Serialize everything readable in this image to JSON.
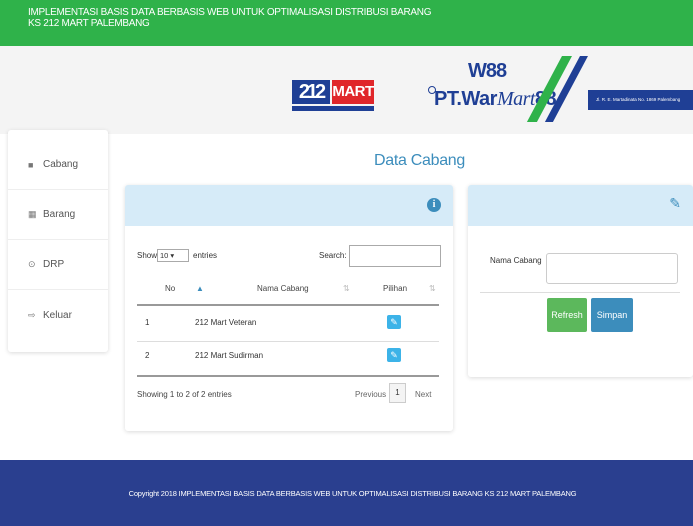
{
  "header": {
    "title_line1": "IMPLEMENTASI BASIS DATA BERBASIS WEB UNTUK OPTIMALISASI DISTRIBUSI BARANG",
    "title_line2": "KS 212 MART PALEMBANG"
  },
  "banner": {
    "logo1_text": "212",
    "logo1_mart": "MART",
    "logo2_code": "W88",
    "logo2_name_prefix": "PT.War",
    "logo2_name_mart": "Mart",
    "logo2_name_num": "88",
    "address": "Jl. R. E. Martadinata No. 1869 Palembang"
  },
  "sidebar": {
    "items": [
      {
        "label": "Cabang",
        "icon": "square-icon"
      },
      {
        "label": "Barang",
        "icon": "grid-icon"
      },
      {
        "label": "DRP",
        "icon": "circle-icon"
      },
      {
        "label": "Keluar",
        "icon": "sign-out-icon"
      }
    ]
  },
  "main": {
    "page_title": "Data Cabang",
    "table_panel": {
      "show_label": "Show",
      "entries_value": "10",
      "entries_label": "entries",
      "search_label": "Search:",
      "search_value": "",
      "columns": [
        "No",
        "Nama Cabang",
        "Pilihan"
      ],
      "rows": [
        {
          "no": "1",
          "nama": "212 Mart Veteran"
        },
        {
          "no": "2",
          "nama": "212 Mart Sudirman"
        }
      ],
      "info_text": "Showing 1 to 2 of 2 entries",
      "previous_label": "Previous",
      "page_number": "1",
      "next_label": "Next"
    },
    "form_panel": {
      "field_label": "Nama Cabang",
      "field_value": "",
      "refresh_label": "Refresh",
      "save_label": "Simpan"
    }
  },
  "footer": {
    "text": "Copyright 2018 IMPLEMENTASI BASIS DATA BERBASIS WEB UNTUK OPTIMALISASI DISTRIBUSI BARANG KS 212 MART PALEMBANG"
  },
  "colors": {
    "header_green": "#2fb24a",
    "accent_blue": "#3c8dbc",
    "panel_head": "#d6ebf8",
    "footer_navy": "#2a3f8f",
    "refresh_green": "#5cb85c"
  }
}
